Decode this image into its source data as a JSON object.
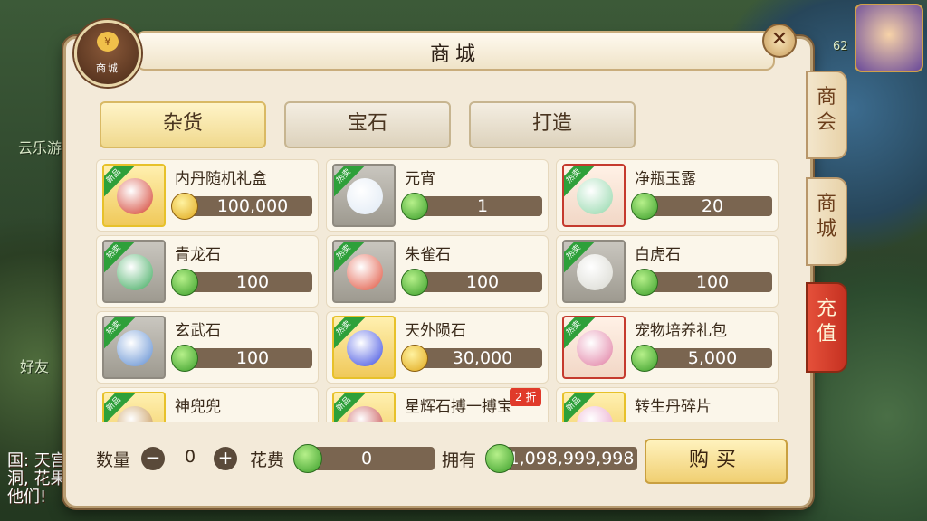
{
  "panel": {
    "title": "商城",
    "logo_label": "商城",
    "logo_coin": "¥",
    "close_symbol": "✕"
  },
  "tabs": [
    {
      "label": "杂货",
      "active": true
    },
    {
      "label": "宝石",
      "active": false
    },
    {
      "label": "打造",
      "active": false
    }
  ],
  "items": [
    {
      "name": "内丹随机礼盒",
      "tag": "新品",
      "price": "100,000",
      "currency": "gold-coin-icon",
      "frame": "gold"
    },
    {
      "name": "元宵",
      "tag": "热卖",
      "price": "1",
      "currency": "jade-coin-icon",
      "frame": "grey"
    },
    {
      "name": "净瓶玉露",
      "tag": "热卖",
      "price": "20",
      "currency": "jade-coin-icon",
      "frame": "red"
    },
    {
      "name": "青龙石",
      "tag": "热卖",
      "price": "100",
      "currency": "jade-coin-icon",
      "frame": "grey"
    },
    {
      "name": "朱雀石",
      "tag": "热卖",
      "price": "100",
      "currency": "jade-coin-icon",
      "frame": "grey"
    },
    {
      "name": "白虎石",
      "tag": "热卖",
      "price": "100",
      "currency": "jade-coin-icon",
      "frame": "grey"
    },
    {
      "name": "玄武石",
      "tag": "热卖",
      "price": "100",
      "currency": "jade-coin-icon",
      "frame": "grey"
    },
    {
      "name": "天外陨石",
      "tag": "热卖",
      "price": "30,000",
      "currency": "gold-coin-icon",
      "frame": "gold"
    },
    {
      "name": "宠物培养礼包",
      "tag": "热卖",
      "price": "5,000",
      "currency": "jade-coin-icon",
      "frame": "red"
    },
    {
      "name": "神兜兜",
      "tag": "新品",
      "price": "",
      "currency": "",
      "frame": "gold"
    },
    {
      "name": "星辉石搏一搏宝",
      "tag": "新品",
      "price": "",
      "currency": "",
      "frame": "gold",
      "badge": "2 折"
    },
    {
      "name": "转生丹碎片",
      "tag": "新品",
      "price": "",
      "currency": "",
      "frame": "gold"
    }
  ],
  "bottom": {
    "quantity_label": "数量",
    "quantity_value": "0",
    "minus": "−",
    "plus": "+",
    "cost_label": "花费",
    "cost_value": "0",
    "own_label": "拥有",
    "own_value": "1,098,999,998",
    "buy_label": "购买"
  },
  "right_tabs": [
    "商会",
    "商城",
    "充值"
  ],
  "side": {
    "yunleyou": "云乐游",
    "friend": "好友",
    "chat_line1": "国: 天宫",
    "chat_line2": "洞, 花果",
    "chat_line3": "他们!",
    "level": "62"
  },
  "colors": {
    "panel_bg": "#f3ead9",
    "active_tab": "#f0d98e",
    "price_bar": "#7a6550",
    "recharge_tab": "#c63222"
  }
}
